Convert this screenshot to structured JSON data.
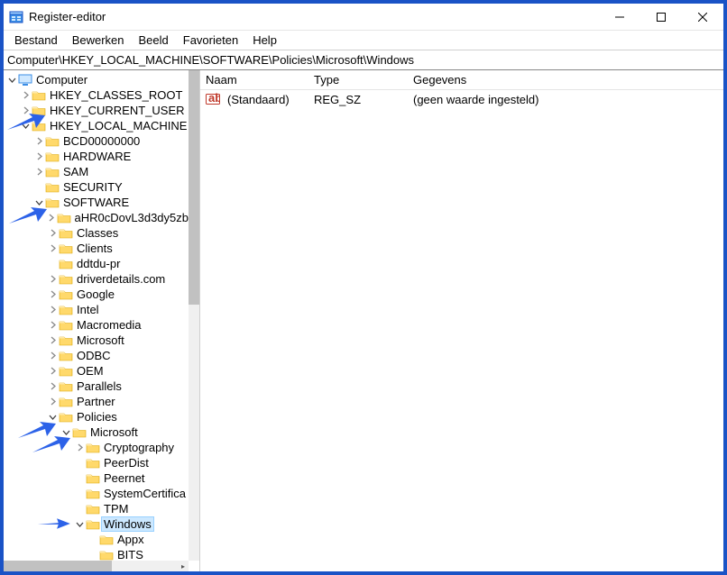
{
  "window": {
    "title": "Register-editor"
  },
  "menu": {
    "file": "Bestand",
    "edit": "Bewerken",
    "view": "Beeld",
    "favorites": "Favorieten",
    "help": "Help"
  },
  "address": "Computer\\HKEY_LOCAL_MACHINE\\SOFTWARE\\Policies\\Microsoft\\Windows",
  "list": {
    "columns": {
      "name": "Naam",
      "type": "Type",
      "data": "Gegevens"
    },
    "rows": [
      {
        "name": "(Standaard)",
        "type": "REG_SZ",
        "data": "(geen waarde ingesteld)"
      }
    ]
  },
  "tree": {
    "computer": "Computer",
    "hkcr": "HKEY_CLASSES_ROOT",
    "hkcu": "HKEY_CURRENT_USER",
    "hklm": "HKEY_LOCAL_MACHINE",
    "bcd": "BCD00000000",
    "hardware": "HARDWARE",
    "sam": "SAM",
    "security": "SECURITY",
    "software": "SOFTWARE",
    "sw_1": "aHR0cDovL3d3dy5zb",
    "sw_classes": "Classes",
    "sw_clients": "Clients",
    "sw_ddtdu": "ddtdu-pr",
    "sw_driver": "driverdetails.com",
    "sw_google": "Google",
    "sw_intel": "Intel",
    "sw_macro": "Macromedia",
    "sw_ms": "Microsoft",
    "sw_odbc": "ODBC",
    "sw_oem": "OEM",
    "sw_parallels": "Parallels",
    "sw_partner": "Partner",
    "policies": "Policies",
    "pol_ms": "Microsoft",
    "ms_crypt": "Cryptography",
    "ms_peerdist": "PeerDist",
    "ms_peernet": "Peernet",
    "ms_syscert": "SystemCertifica",
    "ms_tpm": "TPM",
    "ms_windows": "Windows",
    "win_appx": "Appx",
    "win_bits": "BITS"
  }
}
